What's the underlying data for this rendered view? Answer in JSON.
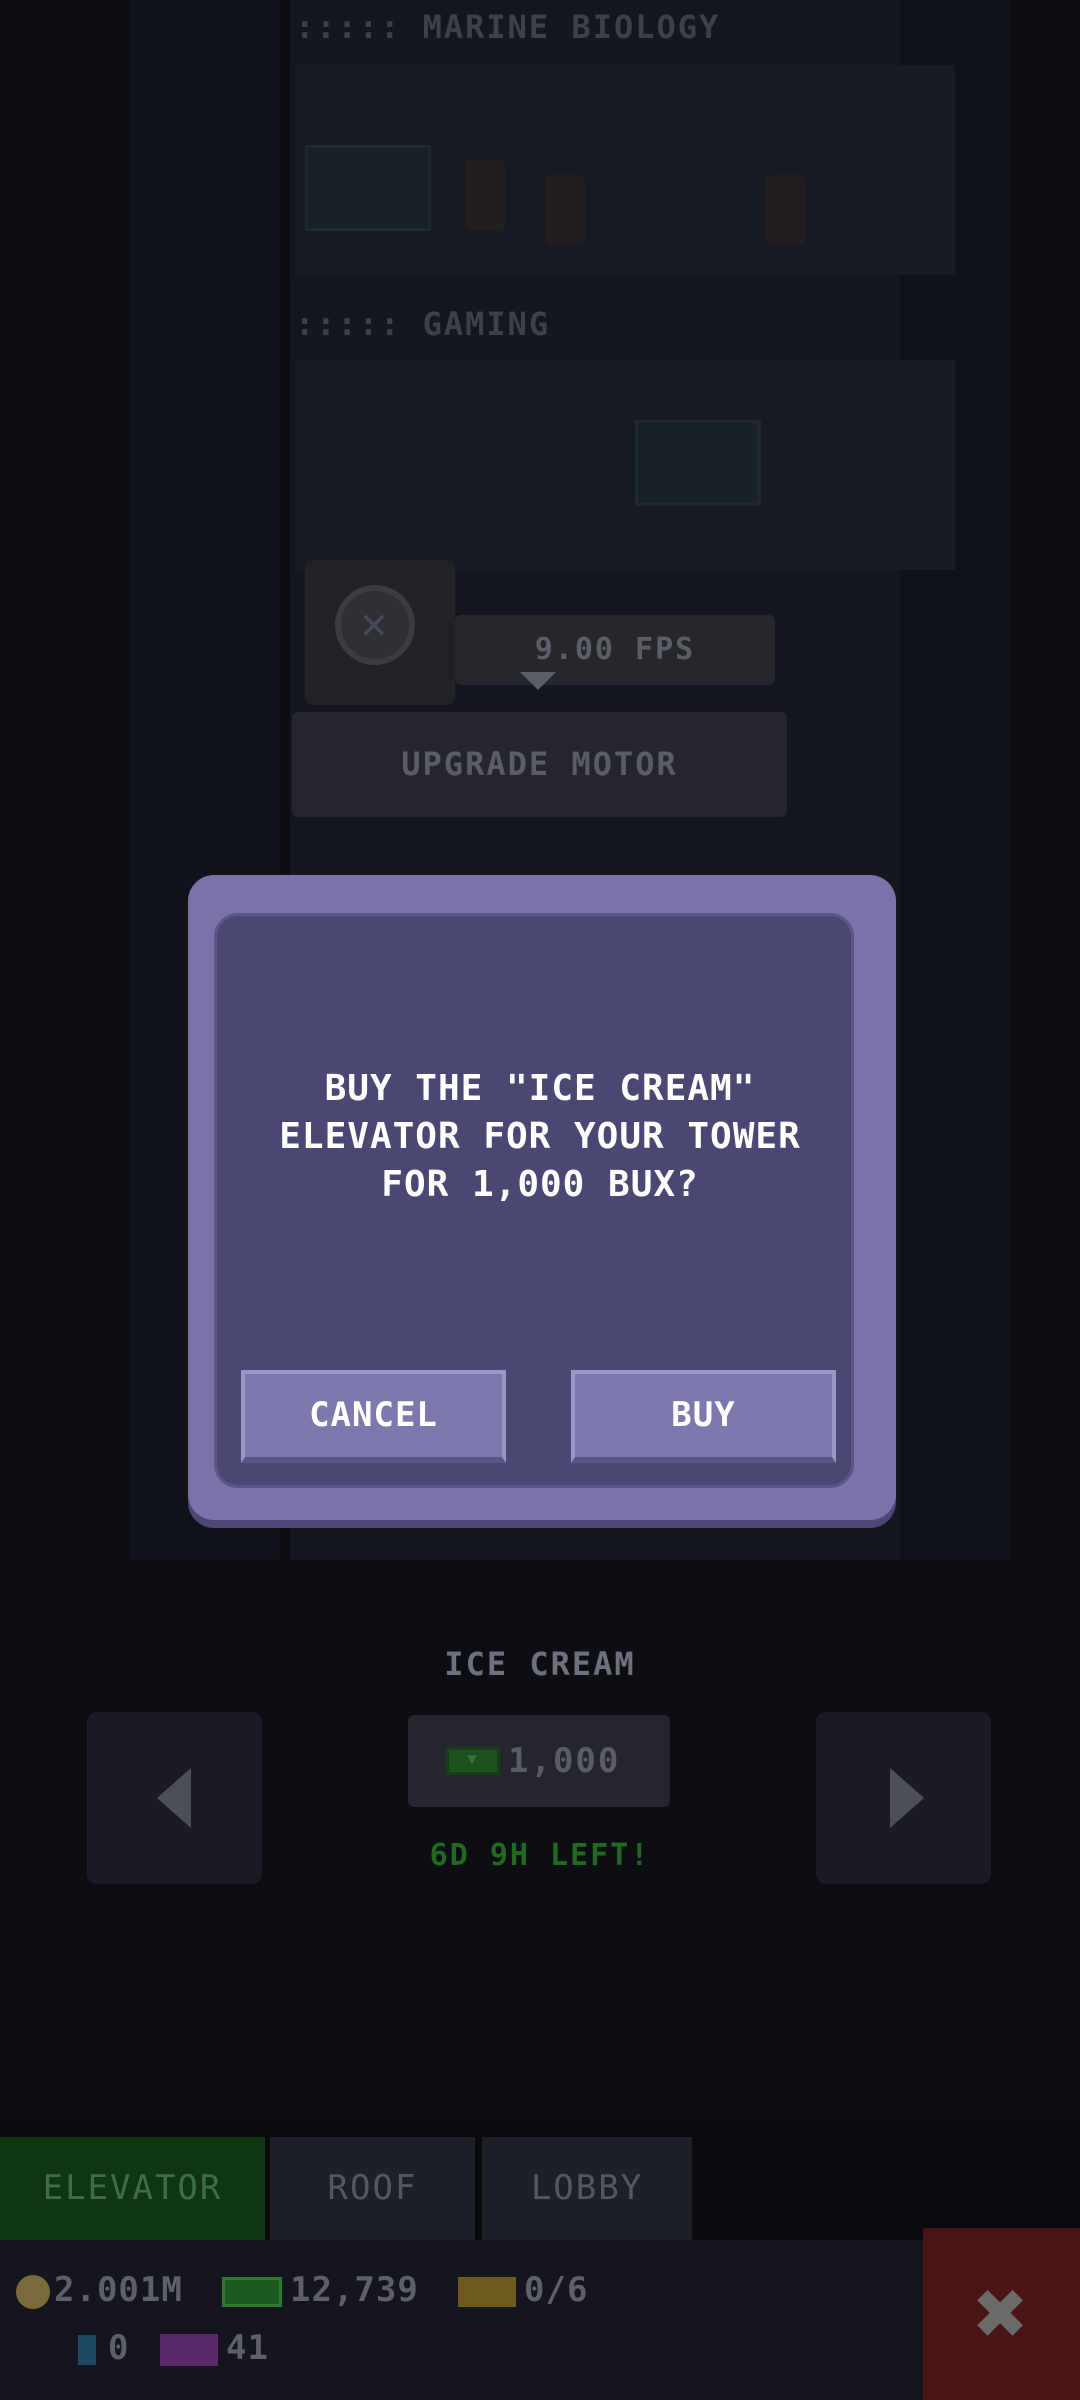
{
  "background": {
    "floors": [
      {
        "label": "::::: MARINE BIOLOGY"
      },
      {
        "label": "::::: GAMING"
      }
    ],
    "motor": {
      "fps": "9.00 FPS",
      "upgrade_label": "UPGRADE MOTOR"
    },
    "elevator_shop": {
      "name": "ICE CREAM",
      "price": "1,000",
      "time_left": "6D 9H LEFT!"
    },
    "tabs": [
      {
        "label": "ELEVATOR",
        "active": true
      },
      {
        "label": "ROOF",
        "active": false
      },
      {
        "label": "LOBBY",
        "active": false
      }
    ],
    "status": {
      "coins": "2.001M",
      "bux": "12,739",
      "tickets": "0/6",
      "gems": "0",
      "tv": "41"
    },
    "close_icon": "close-icon"
  },
  "dialog": {
    "line1": "BUY THE \"ICE CREAM\"",
    "line2": "ELEVATOR FOR YOUR TOWER",
    "line3": "FOR 1,000 BUX?",
    "cancel_label": "CANCEL",
    "buy_label": "BUY"
  },
  "colors": {
    "dialog_frame": "#7a72a8",
    "dialog_fill": "#4a4872",
    "button": "#7d79ae",
    "timer_green": "#1f6a1f"
  }
}
